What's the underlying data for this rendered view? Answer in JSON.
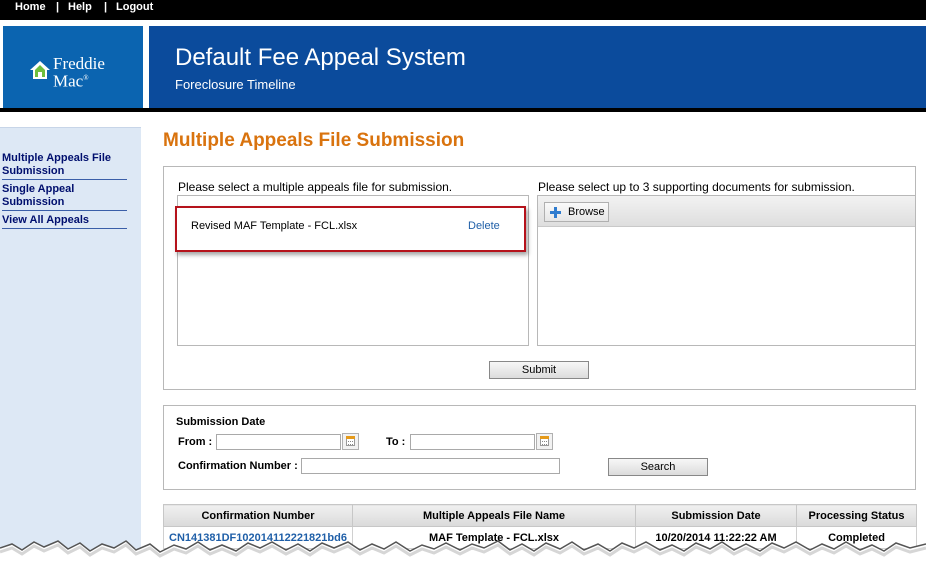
{
  "nav": {
    "home": "Home",
    "help": "Help",
    "logout": "Logout",
    "separator": "|"
  },
  "brand": {
    "line1": "Freddie",
    "line2": "Mac",
    "registered": "®",
    "colors": {
      "logo_bg": "#0b64b0",
      "title_bg": "#0b4b9c",
      "accent": "#d9730e",
      "highlight": "#b5121b"
    }
  },
  "header": {
    "title": "Default Fee Appeal System",
    "subtitle": "Foreclosure Timeline"
  },
  "sidebar": {
    "items": [
      {
        "label": "Multiple Appeals File Submission"
      },
      {
        "label": "Single Appeal Submission"
      },
      {
        "label": "View All Appeals"
      }
    ]
  },
  "main": {
    "page_title": "Multiple Appeals File Submission",
    "file_section_label": "Please select a multiple appeals file for submission.",
    "selected_file": {
      "name": "Revised MAF Template - FCL.xlsx",
      "delete_label": "Delete"
    },
    "docs_section_label": "Please select up to 3 supporting documents for submission.",
    "browse_label": "Browse",
    "submit_label": "Submit"
  },
  "search": {
    "section_label": "Submission Date",
    "from_label": "From :",
    "to_label": "To :",
    "from_value": "",
    "to_value": "",
    "confirmation_label": "Confirmation Number :",
    "confirmation_value": "",
    "search_label": "Search"
  },
  "table": {
    "columns": [
      "Confirmation Number",
      "Multiple Appeals File Name",
      "Submission Date",
      "Processing Status"
    ],
    "rows": [
      {
        "confirmation": "CN141381DF102014112221821bd6",
        "file_name": "MAF Template - FCL.xlsx",
        "date": "10/20/2014 11:22:22 AM",
        "status": "Completed"
      }
    ]
  }
}
